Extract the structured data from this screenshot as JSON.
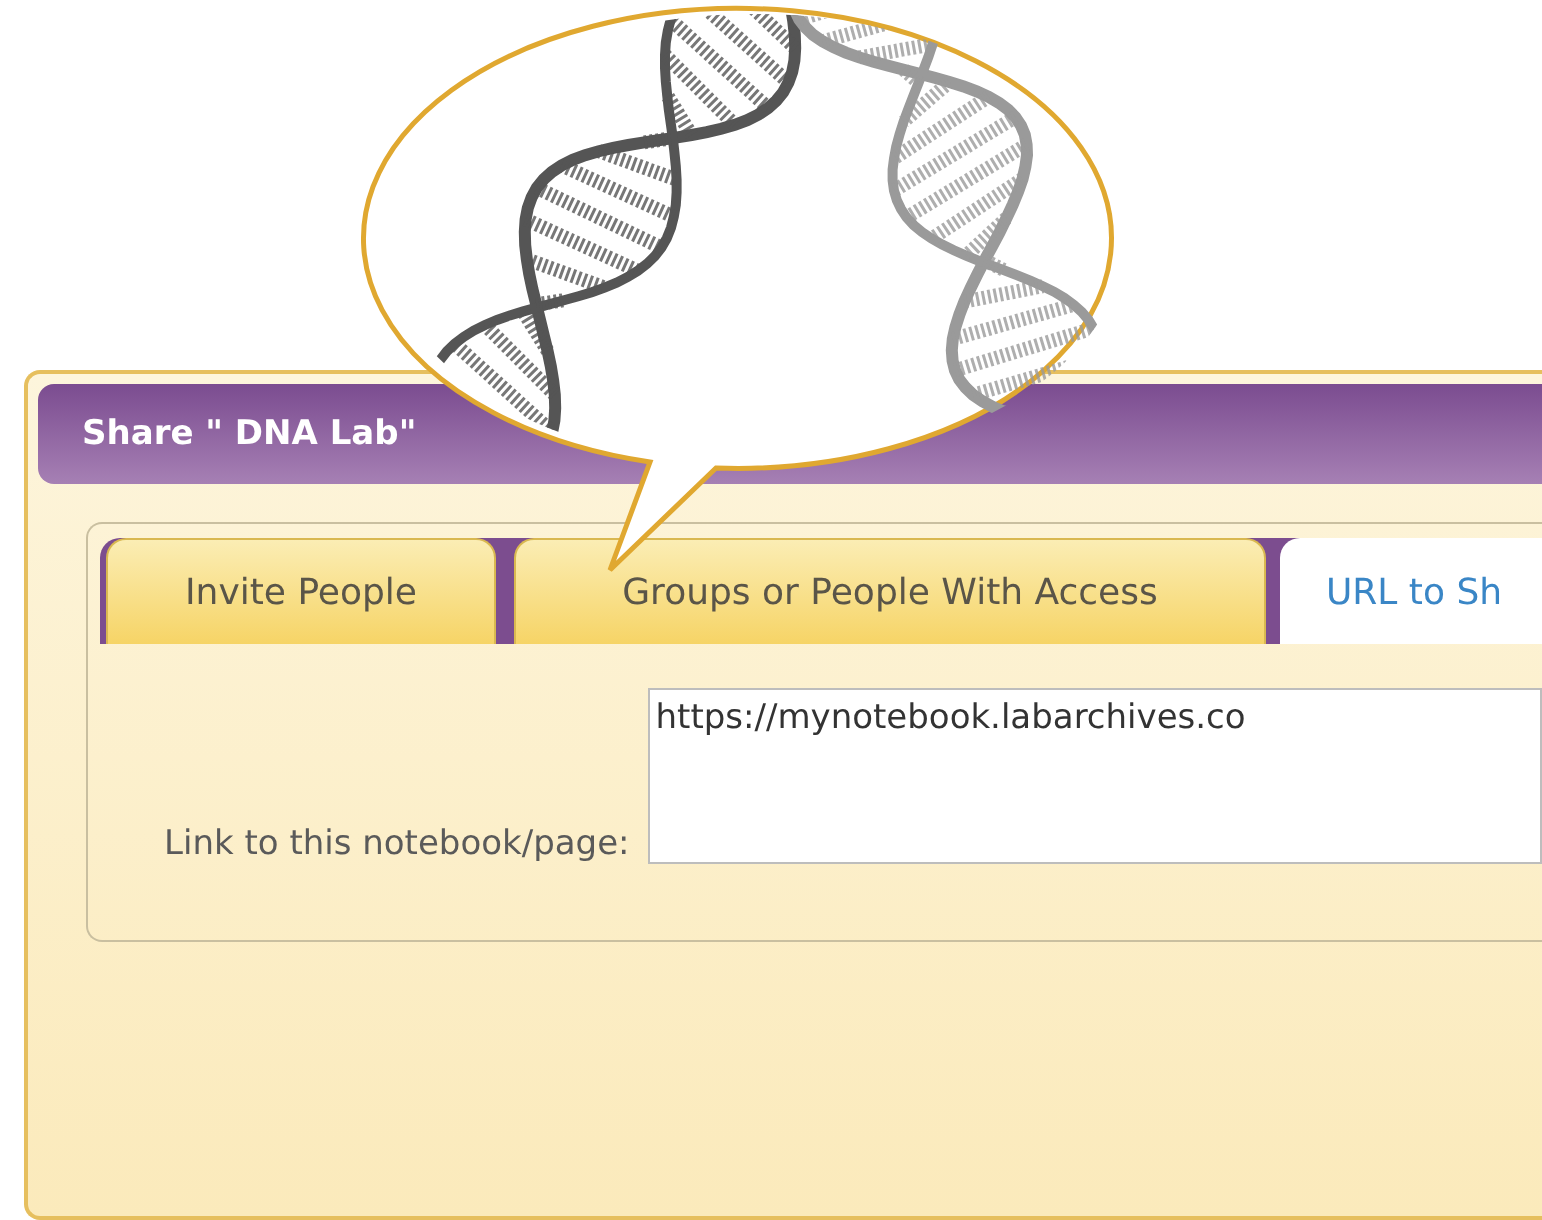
{
  "dialog": {
    "title": "Share \" DNA Lab\""
  },
  "tabs": [
    {
      "label": "Invite People",
      "selected": false
    },
    {
      "label": "Groups or People With Access",
      "selected": false
    },
    {
      "label": "URL to Sh",
      "selected": true
    }
  ],
  "link": {
    "label": "Link to this notebook/page:",
    "value": "https://mynotebook.labarchives.co"
  }
}
